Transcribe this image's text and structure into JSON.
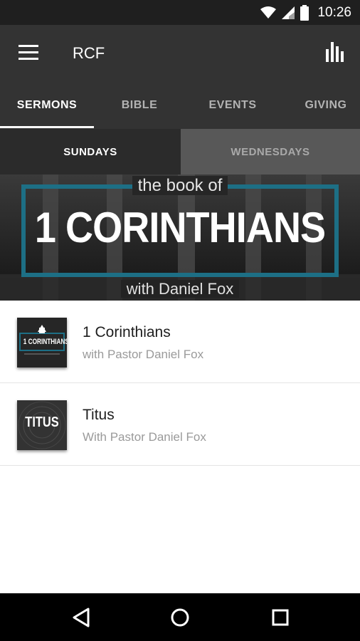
{
  "status_bar": {
    "time": "10:26",
    "icons": [
      "wifi-icon",
      "cell-signal-icon",
      "battery-icon"
    ]
  },
  "app_bar": {
    "title": "RCF",
    "menu_icon": "menu-icon",
    "action_icon": "stats-icon"
  },
  "tabs": [
    {
      "label": "SERMONS",
      "active": true
    },
    {
      "label": "BIBLE",
      "active": false
    },
    {
      "label": "EVENTS",
      "active": false
    },
    {
      "label": "GIVING",
      "active": false
    }
  ],
  "subtabs": [
    {
      "label": "SUNDAYS",
      "active": true
    },
    {
      "label": "WEDNESDAYS",
      "active": false
    }
  ],
  "banner": {
    "top_line": "the book of",
    "title": "1 CORINTHIANS",
    "bottom_line": "with Daniel Fox",
    "frame_color": "#1d6f85"
  },
  "series": [
    {
      "title": "1 Corinthians",
      "subtitle": "with Pastor Daniel Fox",
      "thumb_label": "1 CORINTHIANS"
    },
    {
      "title": "Titus",
      "subtitle": "With Pastor Daniel Fox",
      "thumb_label": "TITUS"
    }
  ],
  "nav_bar": {
    "icons": [
      "back-icon",
      "home-icon",
      "recents-icon"
    ]
  },
  "colors": {
    "app_bar": "#333333",
    "status_bar": "#1f1f1f",
    "accent": "#1d6f85",
    "subtab_inactive": "#585858"
  }
}
